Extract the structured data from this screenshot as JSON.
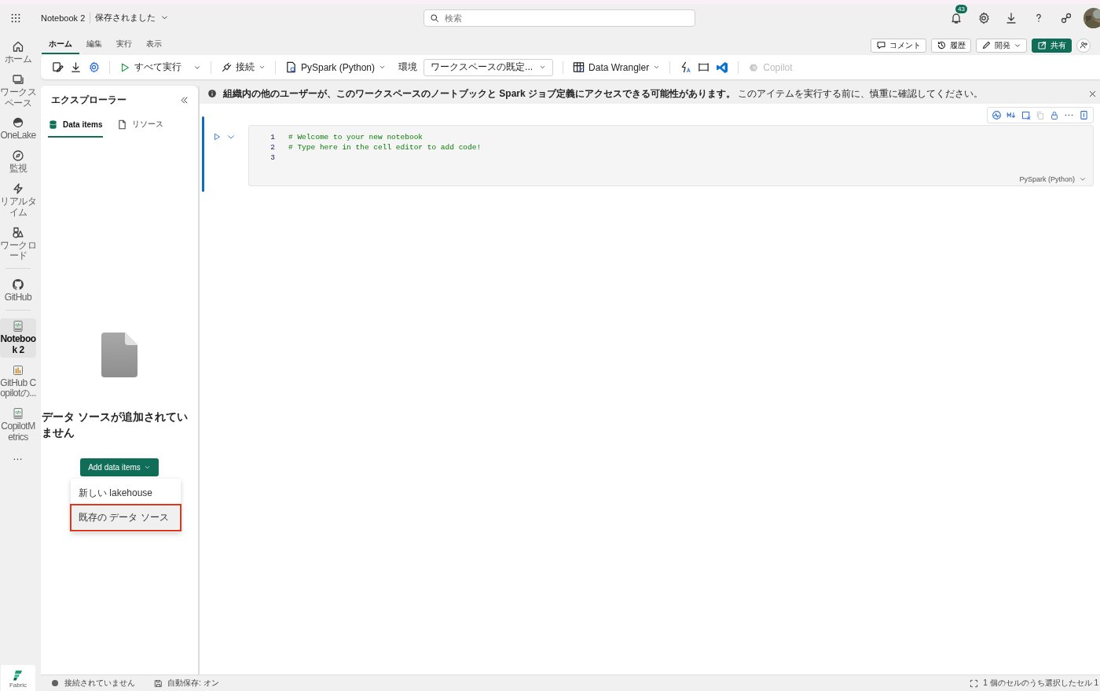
{
  "header": {
    "title": "Notebook 2",
    "save_status": "保存されました",
    "search": {
      "placeholder": "検索"
    },
    "notification_count": "43"
  },
  "nav_rail": {
    "items": [
      {
        "kind": "home",
        "label": "ホーム",
        "selected": false
      },
      {
        "kind": "workspace",
        "label": "ワークスペース",
        "selected": false
      },
      {
        "kind": "onelake",
        "label": "OneLake",
        "selected": false
      },
      {
        "kind": "monitor",
        "label": "監視",
        "selected": false
      },
      {
        "kind": "realtime",
        "label": "リアルタイム",
        "selected": false
      },
      {
        "kind": "workload",
        "label": "ワークロード",
        "selected": false
      },
      {
        "kind": "github",
        "label": "GitHub",
        "selected": false
      },
      {
        "kind": "notebook",
        "label": "Notebook 2",
        "selected": true
      },
      {
        "kind": "report",
        "label": "GitHub Copilotの...",
        "selected": false
      },
      {
        "kind": "notebook",
        "label": "CopilotMetrics",
        "selected": false
      },
      {
        "kind": "more",
        "label": "…",
        "selected": false
      }
    ],
    "footer": "Fabric"
  },
  "ribbon": {
    "tabs": [
      {
        "label": "ホーム",
        "selected": true
      },
      {
        "label": "編集",
        "selected": false
      },
      {
        "label": "実行",
        "selected": false
      },
      {
        "label": "表示",
        "selected": false
      }
    ],
    "actions": [
      {
        "kind": "comment",
        "label": "コメント"
      },
      {
        "kind": "history",
        "label": "履歴"
      },
      {
        "kind": "develop",
        "label": "開発"
      },
      {
        "kind": "share",
        "label": "共有"
      }
    ],
    "toolbar": {
      "run_all": "すべて実行",
      "connect": "接続",
      "language": "PySpark (Python)",
      "environment_label": "環境",
      "environment": "ワークスペースの既定...",
      "data_wrangler": "Data Wrangler",
      "copilot": {
        "label": "Copilot",
        "disabled": true
      }
    }
  },
  "explorer": {
    "title": "エクスプローラー",
    "tabs": [
      {
        "label": "Data items",
        "selected": true
      },
      {
        "label": "リソース",
        "selected": false
      }
    ],
    "empty_title": "データ ソースが追加されていません",
    "add_button": "Add data items",
    "menu": [
      {
        "label": "新しい lakehouse",
        "selected": false
      },
      {
        "label": "既存の データ ソース",
        "selected": true
      }
    ]
  },
  "banner": {
    "text": "**組織内の他のユーザーが、このワークスペースのノートブックと Spark ジョブ定義にアクセスできる可能性があります。** このアイテムを実行する前に、慎重に確認してください。"
  },
  "cell": {
    "lines": [
      {
        "number": "1",
        "code": "# Welcome to your new notebook"
      },
      {
        "number": "2",
        "code": "# Type here in the cell editor to add code!"
      },
      {
        "number": "3"
      }
    ],
    "language": "PySpark (Python)"
  },
  "status_bar": {
    "connection": "接続されていません",
    "autosave": "自動保存: オン",
    "selection": "1 個のセルのうち選択したセル 1"
  }
}
